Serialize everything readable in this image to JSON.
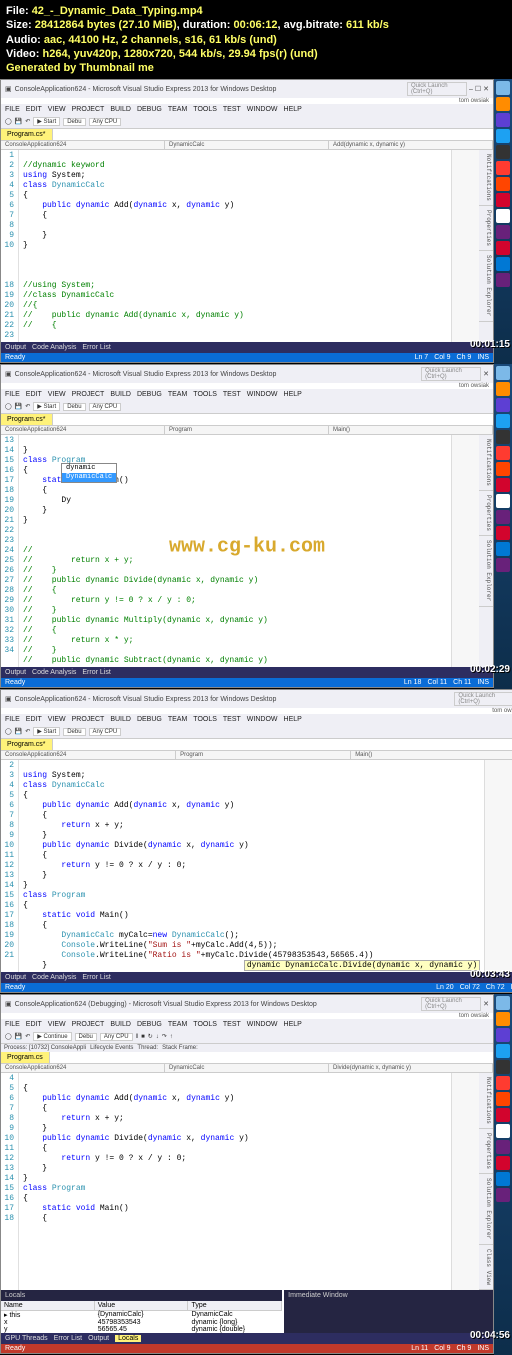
{
  "header": {
    "file_label": "File:",
    "filename": "42_-_Dynamic_Data_Typing.mp4",
    "size_label": "Size:",
    "size_bytes": "28412864 bytes",
    "size_mib": "(27.10 MiB)",
    "duration_label": "duration:",
    "duration": "00:06:12",
    "avgbitrate_label": "avg.bitrate:",
    "avgbitrate": "611 kb/s",
    "audio_label": "Audio:",
    "audio": "aac, 44100 Hz, 2 channels, s16, 61 kb/s (und)",
    "video_label": "Video:",
    "video": "h264, yuv420p, 1280x720, 544 kb/s, 29.94 fps(r) (und)",
    "generated": "Generated by Thumbnail me"
  },
  "watermark": "www.cg-ku.com",
  "vs_title": "ConsoleApplication624 - Microsoft Visual Studio Express 2013 for Windows Desktop",
  "vs_title_debug": "ConsoleApplication624 (Debugging) - Microsoft Visual Studio Express 2013 for Windows Desktop",
  "quick_launch_placeholder": "Quick Launch (Ctrl+Q)",
  "user": "tom owsiak",
  "menus": [
    "FILE",
    "EDIT",
    "VIEW",
    "PROJECT",
    "BUILD",
    "DEBUG",
    "TEAM",
    "TOOLS",
    "TEST",
    "WINDOW",
    "HELP"
  ],
  "toolbar": {
    "start": "Start",
    "debug": "Debu",
    "anycpu": "Any CPU",
    "continue": "Continue"
  },
  "process_line": "Process: [10732] ConsoleAppli",
  "lifecycle": "Lifecycle Events",
  "thread": "Thread:",
  "stack": "Stack Frame:",
  "tabs": {
    "program": "Program.cs*",
    "programplain": "Program.cs"
  },
  "navs": {
    "p1": [
      "ConsoleApplication624",
      "DynamicCalc",
      "Add(dynamic x, dynamic y)"
    ],
    "p2": [
      "ConsoleApplication624",
      "Program",
      "Main()"
    ],
    "p4": [
      "ConsoleApplication624",
      "DynamicCalc",
      "Divide(dynamic x, dynamic y)"
    ]
  },
  "panel1_gutter": "1\n2\n3\n4\n5\n6\n7\n8\n9\n10\n\n\n\n18\n19\n20\n21\n22\n23",
  "panel2_gutter": "13\n14\n15\n16\n17\n18\n19\n20\n21\n22\n23\n24\n25\n26\n27\n28\n29\n30\n31\n32\n33\n34",
  "panel3_gutter": "2\n3\n4\n5\n6\n7\n8\n9\n10\n11\n12\n13\n14\n15\n16\n17\n18\n19\n20\n21",
  "panel4_gutter": "4\n5\n6\n7\n8\n9\n10\n11\n12\n13\n14\n15\n16\n17\n18",
  "code1": {
    "l1_cm": "//dynamic keyword",
    "l2": "using System;",
    "l3": "class DynamicCalc",
    "l5": "    public dynamic Add(dynamic x, dynamic y)",
    "l18": "//using System;",
    "l19": "//class DynamicCalc",
    "l21": "//    public dynamic Add(dynamic x, dynamic y)"
  },
  "code2": {
    "l14": "class Program",
    "l16": "    static void Main()",
    "l18": "        Dy",
    "intellisense_item": "dynamic",
    "intellisense_sel": "DynamicCalc",
    "l24": "//        return x + y;",
    "l26": "//    public dynamic Divide(dynamic x, dynamic y)",
    "l28": "//        return y != 0 ? x / y : 0;",
    "l30": "//    public dynamic Multiply(dynamic x, dynamic y)",
    "l32": "//        return x * y;",
    "l34": "//    public dynamic Subtract(dynamic x, dynamic y)"
  },
  "code3": {
    "l2": "using System;",
    "l3": "class DynamicCalc",
    "l5": "    public dynamic Add(dynamic x, dynamic y)",
    "l7": "        return x + y;",
    "l9": "    public dynamic Divide(dynamic x, dynamic y)",
    "l11": "        return y != 0 ? x / y : 0;",
    "l14": "class Program",
    "l16": "    static void Main()",
    "l18a": "        DynamicCalc myCalc=new DynamicCalc();",
    "l19a": "        Console.WriteLine(\"Sum is \"+myCalc.Add(4,5));",
    "l20a": "        Console.WriteLine(\"Ratio is \"+myCalc.Divide(45798353543,56565.4))",
    "tooltip": "dynamic DynamicCalc.Divide(dynamic x, dynamic y)"
  },
  "code4": {
    "l5": "    public dynamic Add(dynamic x, dynamic y)",
    "l7": "        return x + y;",
    "l9": "    public dynamic Divide(dynamic x, dynamic y)",
    "l11": "        return y != 0 ? x / y : 0;",
    "l14": "class Program",
    "l16": "    static void Main()"
  },
  "output_tabs": [
    "Output",
    "Code Analysis",
    "Error List"
  ],
  "output_tabs4": [
    "GPU Threads",
    "Error List",
    "Output",
    "Locals"
  ],
  "status": {
    "ready": "Ready",
    "p1": {
      "ln": "Ln 7",
      "col": "Col 9",
      "ch": "Ch 9",
      "ins": "INS"
    },
    "p2": {
      "ln": "Ln 18",
      "col": "Col 11",
      "ch": "Ch 11",
      "ins": "INS"
    },
    "p3": {
      "ln": "Ln 20",
      "col": "Col 72",
      "ch": "Ch 72",
      "ins": "INS"
    },
    "p4": {
      "ln": "Ln 11",
      "col": "Col 9",
      "ch": "Ch 9",
      "ins": "INS"
    }
  },
  "timestamps": {
    "p1": "00:01:15",
    "p2": "00:02:29",
    "p3": "00:03:43",
    "p4": "00:04:56"
  },
  "side": {
    "notifications": "Notifications",
    "properties": "Properties",
    "solution": "Solution Explorer",
    "classview": "Class View"
  },
  "locals": {
    "title": "Locals",
    "headers": [
      "Name",
      "Value",
      "Type"
    ],
    "rows": [
      {
        "name": "this",
        "value": "{DynamicCalc}",
        "type": "DynamicCalc"
      },
      {
        "name": "x",
        "value": "45798353543",
        "type": "dynamic {long}"
      },
      {
        "name": "y",
        "value": "56565.45",
        "type": "dynamic {double}"
      }
    ]
  },
  "immediate_title": "Immediate Window",
  "taskbar_colors": [
    "#7cb9e8",
    "#ff8c00",
    "#5d3fd3",
    "#1da1f2",
    "#333",
    "#ff3b30",
    "#ff4500",
    "#d2042d",
    "#fff",
    "#68217a",
    "#d2042d",
    "#0078d4",
    "#68217a",
    "#0078d4"
  ]
}
